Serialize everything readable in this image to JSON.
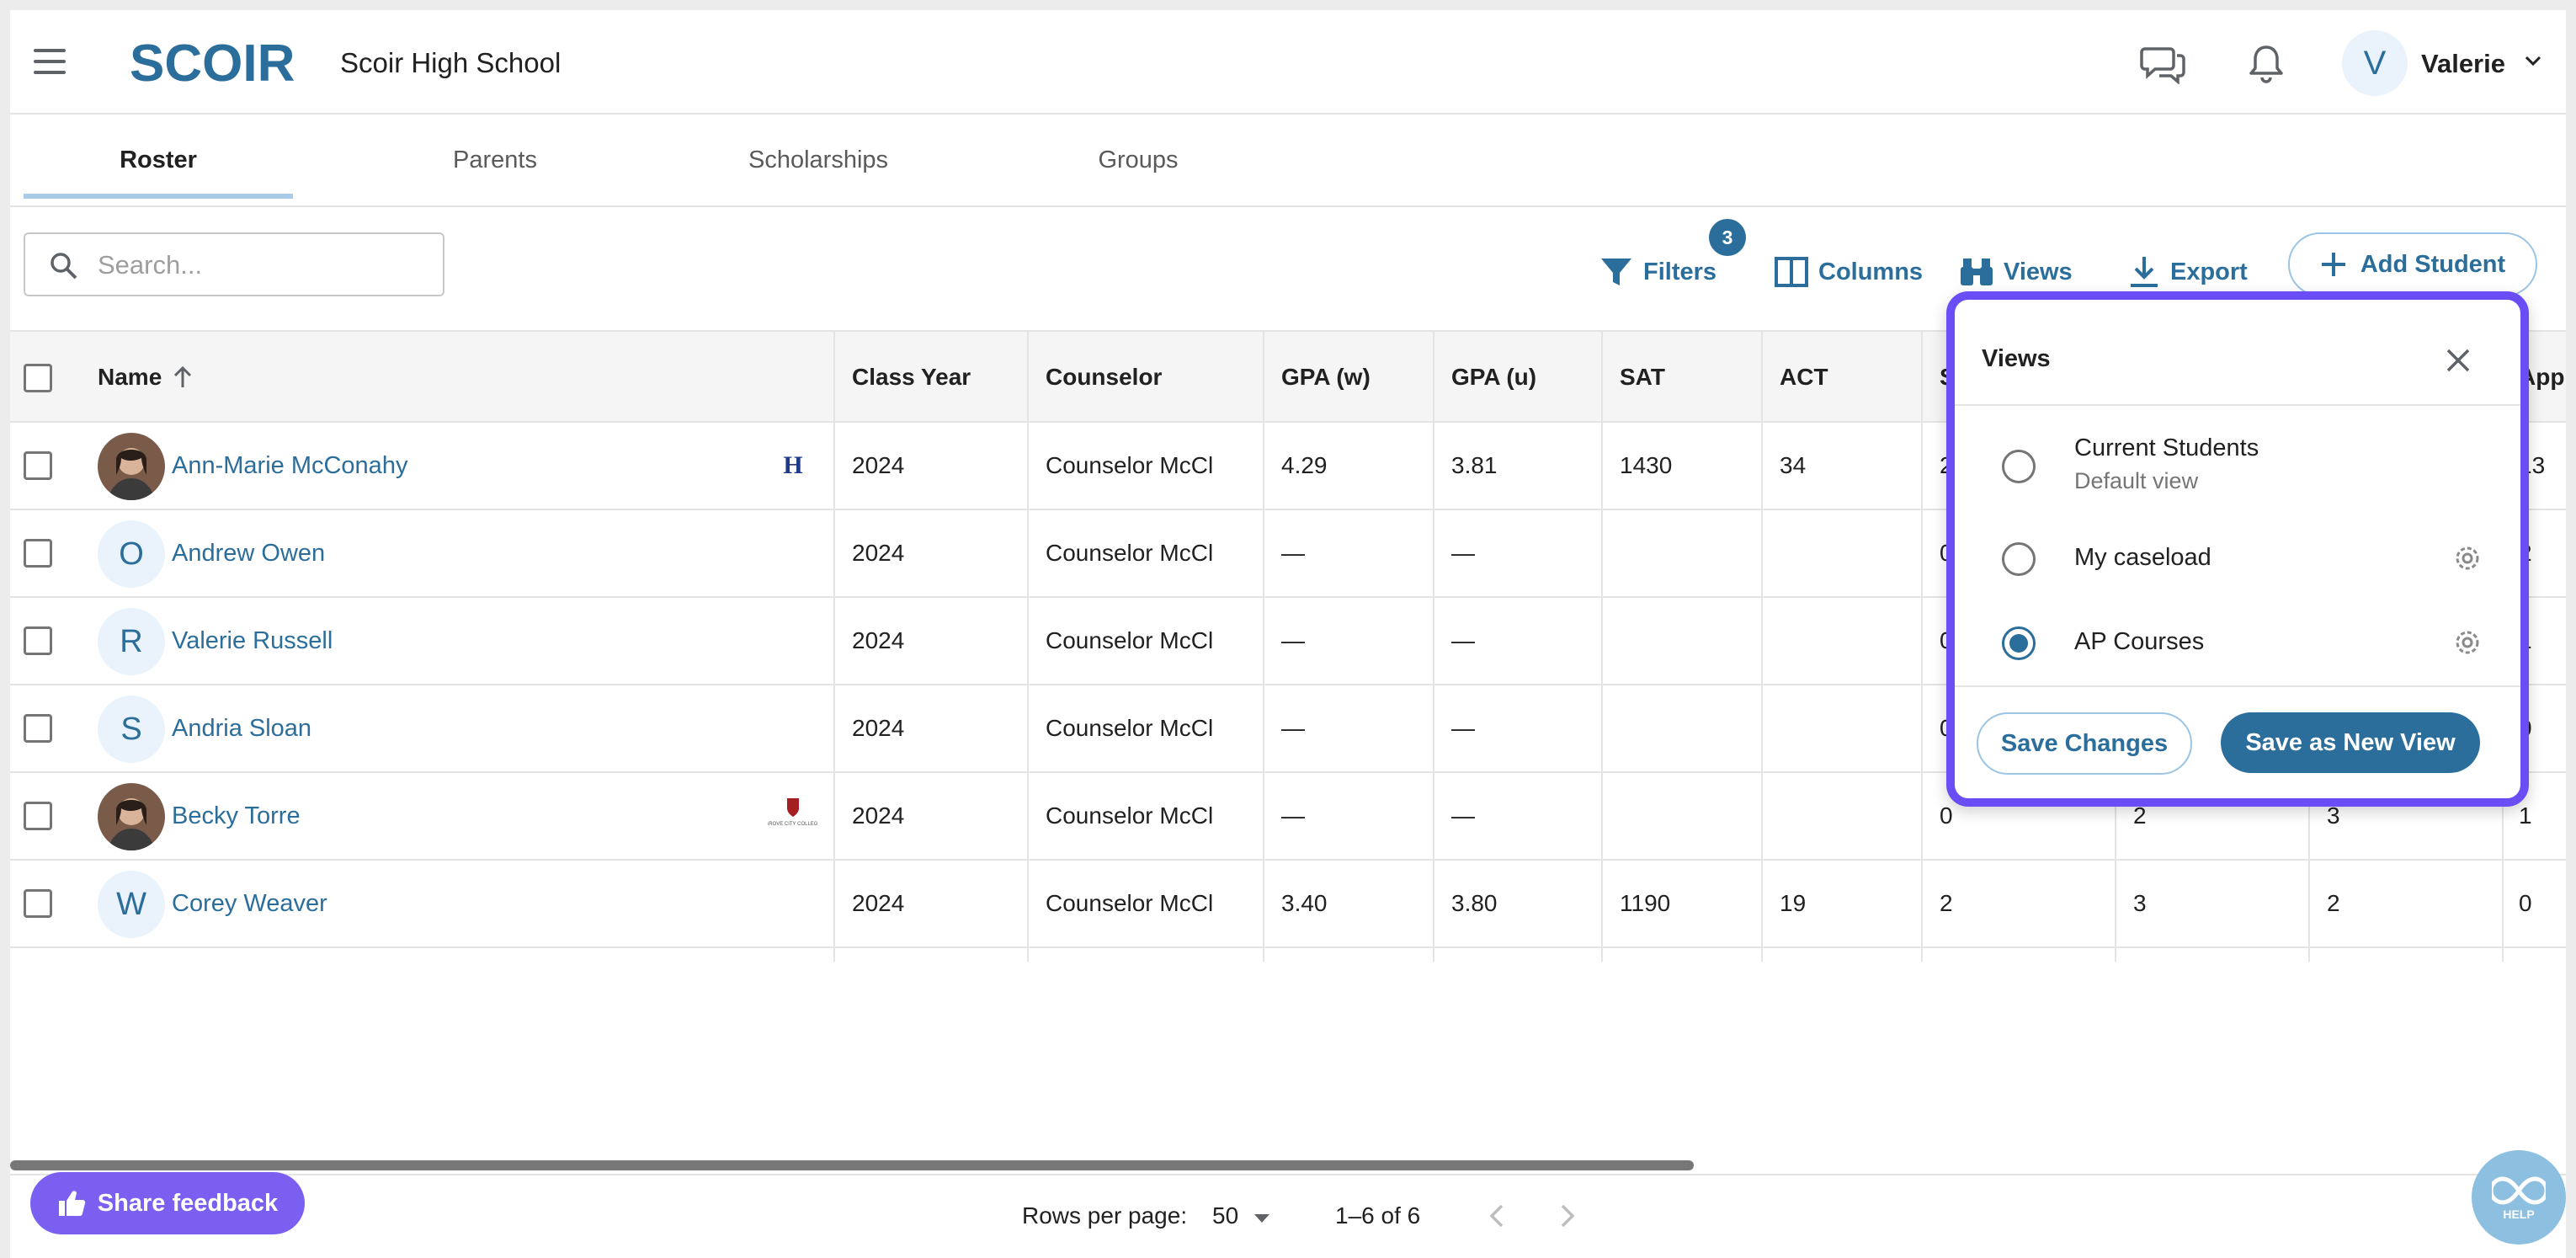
{
  "app": {
    "logo_text": "SCOIR",
    "school_name": "Scoir High School",
    "user_initial": "V",
    "user_name": "Valerie"
  },
  "tabs": [
    {
      "label": "Roster",
      "active": true
    },
    {
      "label": "Parents",
      "active": false
    },
    {
      "label": "Scholarships",
      "active": false
    },
    {
      "label": "Groups",
      "active": false
    }
  ],
  "toolbar": {
    "search_placeholder": "Search...",
    "filters_label": "Filters",
    "filters_count": "3",
    "columns_label": "Columns",
    "views_label": "Views",
    "export_label": "Export",
    "add_student_label": "Add Student"
  },
  "table": {
    "headers": [
      "Name",
      "Class Year",
      "Counselor",
      "GPA (w)",
      "GPA (u)",
      "SAT",
      "ACT",
      "S",
      "",
      "",
      "Appl"
    ],
    "rows": [
      {
        "avatar": "photo",
        "initial": "",
        "name": "Ann-Marie McConahy",
        "college_logo": "H",
        "class_year": "2024",
        "counselor": "Counselor McClo...",
        "gpa_w": "4.29",
        "gpa_u": "3.81",
        "sat": "1430",
        "act": "34",
        "c8": "2",
        "c9": "",
        "c10": "",
        "appl": "13"
      },
      {
        "avatar": "initial",
        "initial": "O",
        "name": "Andrew Owen",
        "college_logo": "",
        "class_year": "2024",
        "counselor": "Counselor McClo...",
        "gpa_w": "—",
        "gpa_u": "—",
        "sat": "",
        "act": "",
        "c8": "0",
        "c9": "",
        "c10": "",
        "appl": "2"
      },
      {
        "avatar": "initial",
        "initial": "R",
        "name": "Valerie Russell",
        "college_logo": "",
        "class_year": "2024",
        "counselor": "Counselor McClo...",
        "gpa_w": "—",
        "gpa_u": "—",
        "sat": "",
        "act": "",
        "c8": "0",
        "c9": "",
        "c10": "",
        "appl": "1"
      },
      {
        "avatar": "initial",
        "initial": "S",
        "name": "Andria Sloan",
        "college_logo": "",
        "class_year": "2024",
        "counselor": "Counselor McClo...",
        "gpa_w": "—",
        "gpa_u": "—",
        "sat": "",
        "act": "",
        "c8": "0",
        "c9": "",
        "c10": "",
        "appl": "0"
      },
      {
        "avatar": "photo",
        "initial": "",
        "name": "Becky Torre",
        "college_logo": "GROVE CITY COLLEGE",
        "class_year": "2024",
        "counselor": "Counselor McClo...",
        "gpa_w": "—",
        "gpa_u": "—",
        "sat": "",
        "act": "",
        "c8": "0",
        "c9": "2",
        "c10": "3",
        "appl": "1"
      },
      {
        "avatar": "initial",
        "initial": "W",
        "name": "Corey Weaver",
        "college_logo": "",
        "class_year": "2024",
        "counselor": "Counselor McClo...",
        "gpa_w": "3.40",
        "gpa_u": "3.80",
        "sat": "1190",
        "act": "19",
        "c8": "2",
        "c9": "3",
        "c10": "2",
        "appl": "0"
      }
    ]
  },
  "footer": {
    "rows_per_page_label": "Rows per page:",
    "rows_per_page_value": "50",
    "page_range": "1–6 of 6",
    "share_feedback_label": "Share feedback",
    "help_label": "HELP"
  },
  "views_panel": {
    "title": "Views",
    "options": [
      {
        "label": "Current Students",
        "sublabel": "Default view",
        "selected": false,
        "has_settings": false
      },
      {
        "label": "My caseload",
        "sublabel": "",
        "selected": false,
        "has_settings": true
      },
      {
        "label": "AP Courses",
        "sublabel": "",
        "selected": true,
        "has_settings": true
      }
    ],
    "save_changes_label": "Save Changes",
    "save_new_label": "Save as New View"
  },
  "colors": {
    "accent": "#2c6e9b",
    "popover_outline": "#6b4df5",
    "feedback_button": "#7b5ff0",
    "help_button": "#8dbfe0"
  }
}
